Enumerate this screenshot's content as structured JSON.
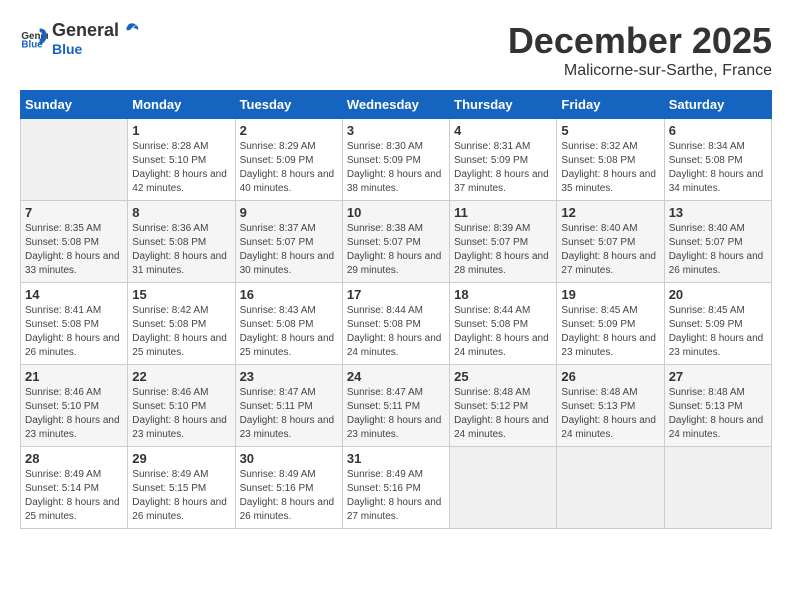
{
  "header": {
    "logo_general": "General",
    "logo_blue": "Blue",
    "month": "December 2025",
    "location": "Malicorne-sur-Sarthe, France"
  },
  "calendar": {
    "days_of_week": [
      "Sunday",
      "Monday",
      "Tuesday",
      "Wednesday",
      "Thursday",
      "Friday",
      "Saturday"
    ],
    "weeks": [
      [
        {
          "day": "",
          "empty": true
        },
        {
          "day": "1",
          "sunrise": "8:28 AM",
          "sunset": "5:10 PM",
          "daylight": "8 hours and 42 minutes."
        },
        {
          "day": "2",
          "sunrise": "8:29 AM",
          "sunset": "5:09 PM",
          "daylight": "8 hours and 40 minutes."
        },
        {
          "day": "3",
          "sunrise": "8:30 AM",
          "sunset": "5:09 PM",
          "daylight": "8 hours and 38 minutes."
        },
        {
          "day": "4",
          "sunrise": "8:31 AM",
          "sunset": "5:09 PM",
          "daylight": "8 hours and 37 minutes."
        },
        {
          "day": "5",
          "sunrise": "8:32 AM",
          "sunset": "5:08 PM",
          "daylight": "8 hours and 35 minutes."
        },
        {
          "day": "6",
          "sunrise": "8:34 AM",
          "sunset": "5:08 PM",
          "daylight": "8 hours and 34 minutes."
        }
      ],
      [
        {
          "day": "7",
          "sunrise": "8:35 AM",
          "sunset": "5:08 PM",
          "daylight": "8 hours and 33 minutes."
        },
        {
          "day": "8",
          "sunrise": "8:36 AM",
          "sunset": "5:08 PM",
          "daylight": "8 hours and 31 minutes."
        },
        {
          "day": "9",
          "sunrise": "8:37 AM",
          "sunset": "5:07 PM",
          "daylight": "8 hours and 30 minutes."
        },
        {
          "day": "10",
          "sunrise": "8:38 AM",
          "sunset": "5:07 PM",
          "daylight": "8 hours and 29 minutes."
        },
        {
          "day": "11",
          "sunrise": "8:39 AM",
          "sunset": "5:07 PM",
          "daylight": "8 hours and 28 minutes."
        },
        {
          "day": "12",
          "sunrise": "8:40 AM",
          "sunset": "5:07 PM",
          "daylight": "8 hours and 27 minutes."
        },
        {
          "day": "13",
          "sunrise": "8:40 AM",
          "sunset": "5:07 PM",
          "daylight": "8 hours and 26 minutes."
        }
      ],
      [
        {
          "day": "14",
          "sunrise": "8:41 AM",
          "sunset": "5:08 PM",
          "daylight": "8 hours and 26 minutes."
        },
        {
          "day": "15",
          "sunrise": "8:42 AM",
          "sunset": "5:08 PM",
          "daylight": "8 hours and 25 minutes."
        },
        {
          "day": "16",
          "sunrise": "8:43 AM",
          "sunset": "5:08 PM",
          "daylight": "8 hours and 25 minutes."
        },
        {
          "day": "17",
          "sunrise": "8:44 AM",
          "sunset": "5:08 PM",
          "daylight": "8 hours and 24 minutes."
        },
        {
          "day": "18",
          "sunrise": "8:44 AM",
          "sunset": "5:08 PM",
          "daylight": "8 hours and 24 minutes."
        },
        {
          "day": "19",
          "sunrise": "8:45 AM",
          "sunset": "5:09 PM",
          "daylight": "8 hours and 23 minutes."
        },
        {
          "day": "20",
          "sunrise": "8:45 AM",
          "sunset": "5:09 PM",
          "daylight": "8 hours and 23 minutes."
        }
      ],
      [
        {
          "day": "21",
          "sunrise": "8:46 AM",
          "sunset": "5:10 PM",
          "daylight": "8 hours and 23 minutes."
        },
        {
          "day": "22",
          "sunrise": "8:46 AM",
          "sunset": "5:10 PM",
          "daylight": "8 hours and 23 minutes."
        },
        {
          "day": "23",
          "sunrise": "8:47 AM",
          "sunset": "5:11 PM",
          "daylight": "8 hours and 23 minutes."
        },
        {
          "day": "24",
          "sunrise": "8:47 AM",
          "sunset": "5:11 PM",
          "daylight": "8 hours and 23 minutes."
        },
        {
          "day": "25",
          "sunrise": "8:48 AM",
          "sunset": "5:12 PM",
          "daylight": "8 hours and 24 minutes."
        },
        {
          "day": "26",
          "sunrise": "8:48 AM",
          "sunset": "5:13 PM",
          "daylight": "8 hours and 24 minutes."
        },
        {
          "day": "27",
          "sunrise": "8:48 AM",
          "sunset": "5:13 PM",
          "daylight": "8 hours and 24 minutes."
        }
      ],
      [
        {
          "day": "28",
          "sunrise": "8:49 AM",
          "sunset": "5:14 PM",
          "daylight": "8 hours and 25 minutes."
        },
        {
          "day": "29",
          "sunrise": "8:49 AM",
          "sunset": "5:15 PM",
          "daylight": "8 hours and 26 minutes."
        },
        {
          "day": "30",
          "sunrise": "8:49 AM",
          "sunset": "5:16 PM",
          "daylight": "8 hours and 26 minutes."
        },
        {
          "day": "31",
          "sunrise": "8:49 AM",
          "sunset": "5:16 PM",
          "daylight": "8 hours and 27 minutes."
        },
        {
          "day": "",
          "empty": true
        },
        {
          "day": "",
          "empty": true
        },
        {
          "day": "",
          "empty": true
        }
      ]
    ]
  }
}
